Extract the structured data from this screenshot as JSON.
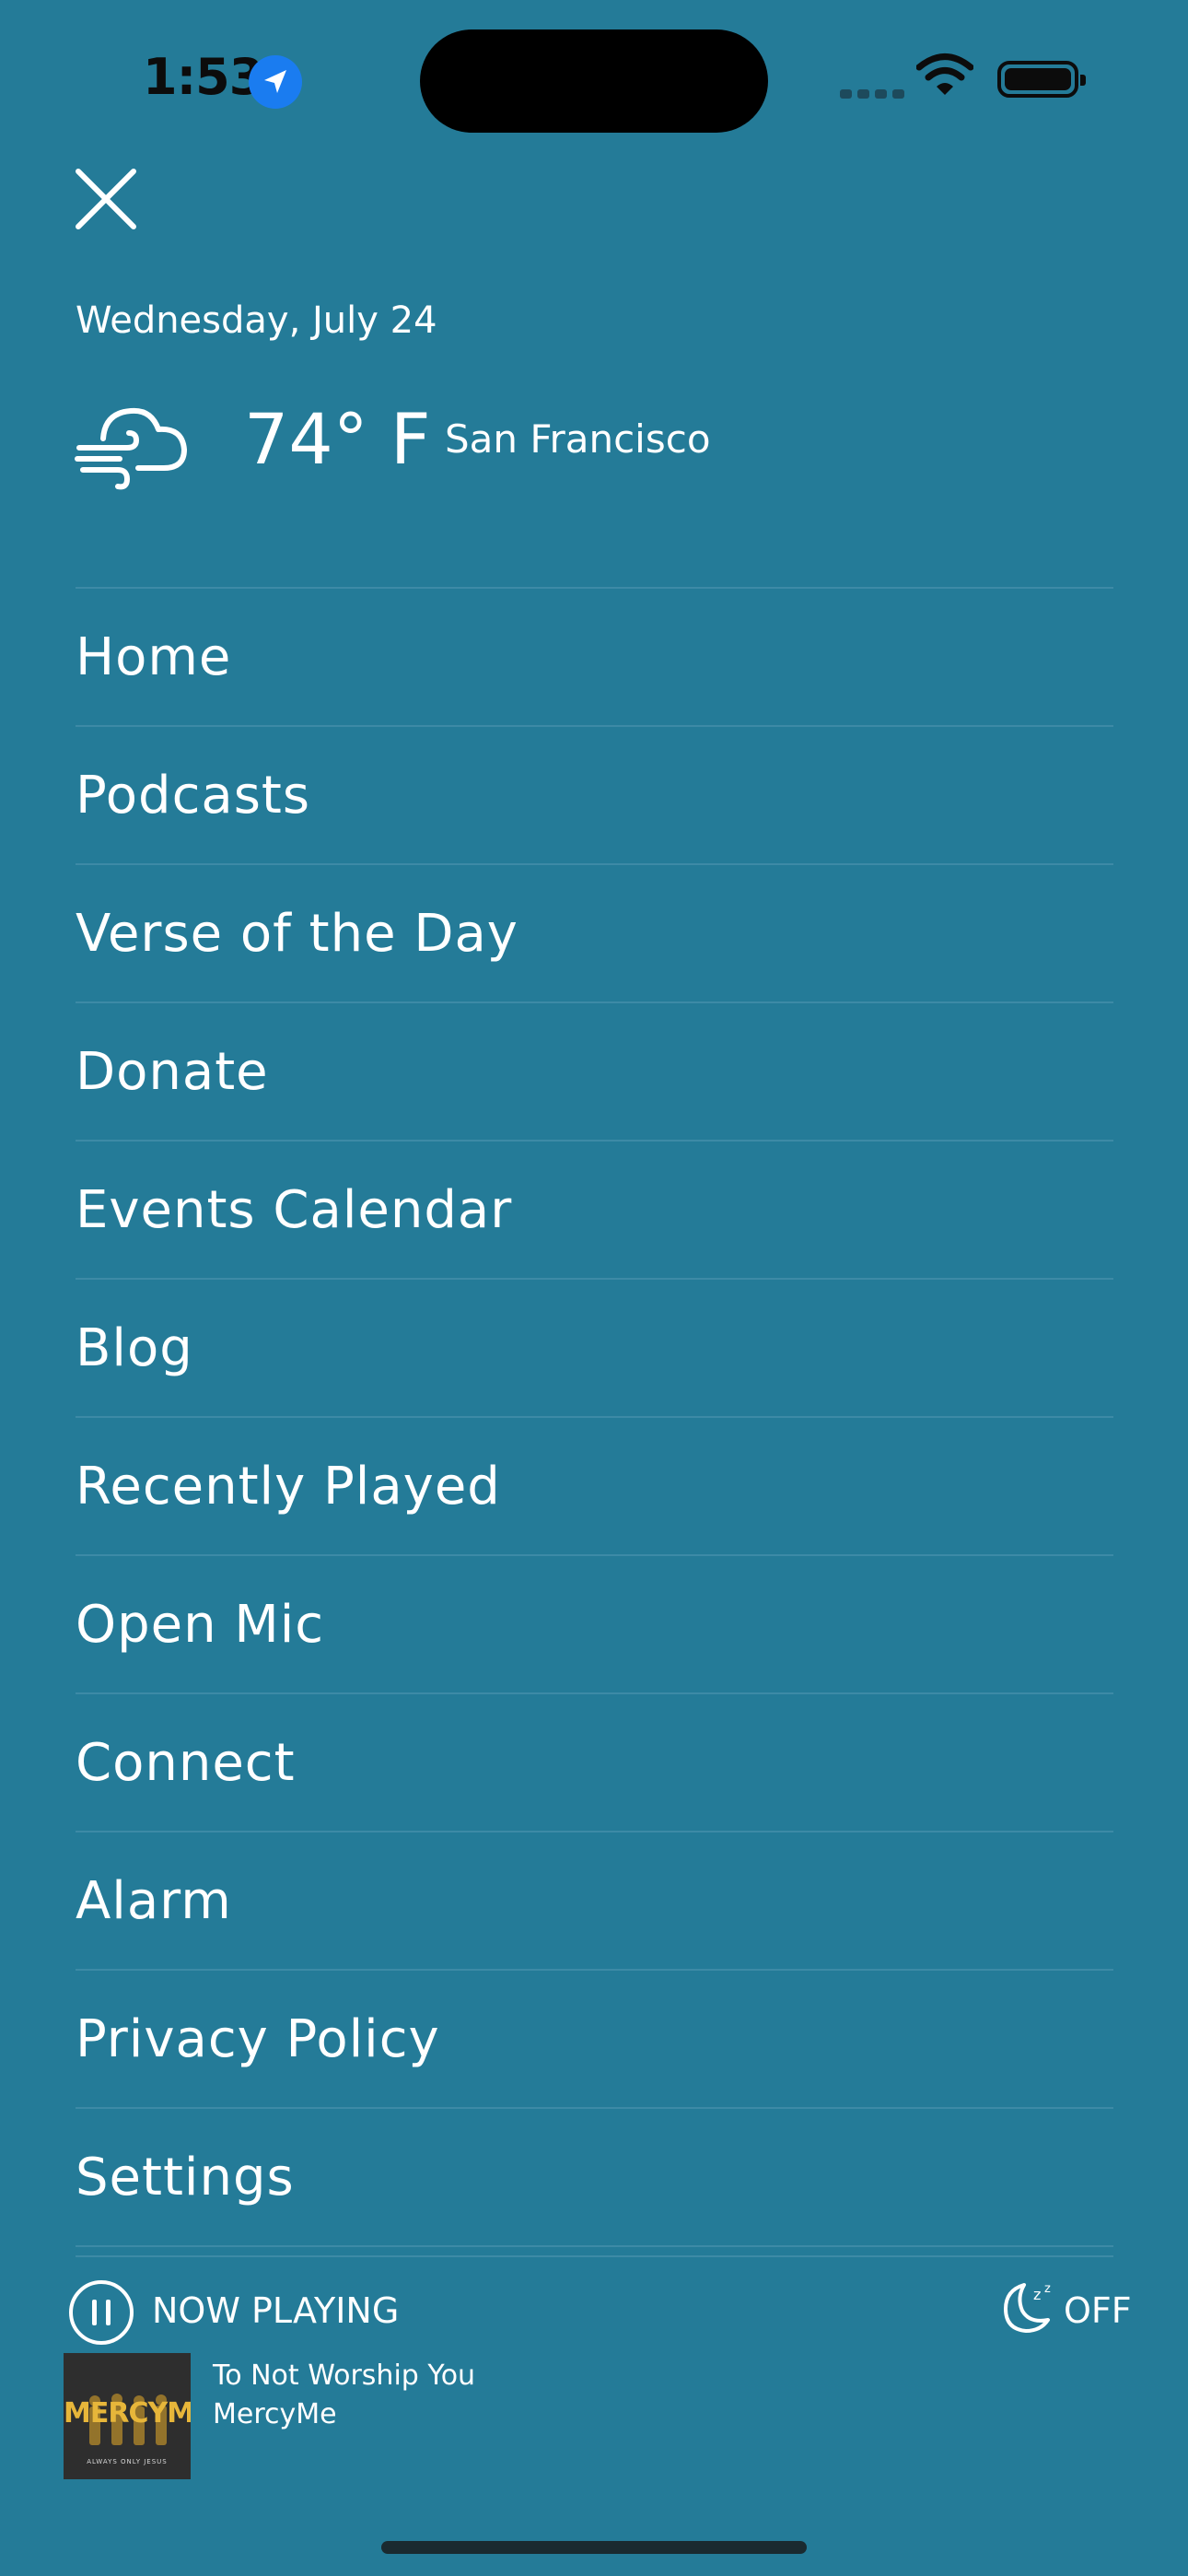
{
  "status_bar": {
    "time": "1:53"
  },
  "header": {
    "date": "Wednesday, July 24",
    "temperature": "74° F",
    "city": "San Francisco",
    "weather_icon": "windy-cloud-icon"
  },
  "menu": {
    "items": [
      {
        "label": "Home"
      },
      {
        "label": "Podcasts"
      },
      {
        "label": "Verse of the Day"
      },
      {
        "label": "Donate"
      },
      {
        "label": "Events Calendar"
      },
      {
        "label": "Blog"
      },
      {
        "label": "Recently Played"
      },
      {
        "label": "Open Mic"
      },
      {
        "label": "Connect"
      },
      {
        "label": "Alarm"
      },
      {
        "label": "Privacy Policy"
      },
      {
        "label": "Settings"
      }
    ]
  },
  "player": {
    "now_playing_label": "NOW PLAYING",
    "sleep_timer": "OFF",
    "song_title": "To Not Worship You",
    "artist": "MercyMe",
    "album_art_text": "MERCYME",
    "album_art_subtext": "ALWAYS ONLY JESUS"
  },
  "colors": {
    "background": "#247b98",
    "divider": "#3d8aa6",
    "text": "#ffffff"
  }
}
